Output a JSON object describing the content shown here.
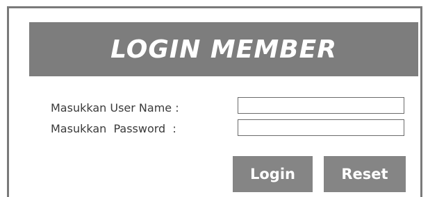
{
  "header": {
    "title": "LOGIN MEMBER"
  },
  "form": {
    "username_label": "Masukkan User Name :",
    "username_value": "",
    "password_label": "Masukkan  Password  :",
    "password_value": ""
  },
  "buttons": {
    "login_label": "Login",
    "reset_label": "Reset"
  },
  "colors": {
    "header_bg": "#7d7d7d",
    "button_bg": "#858585",
    "text": "#3a3a3a"
  }
}
